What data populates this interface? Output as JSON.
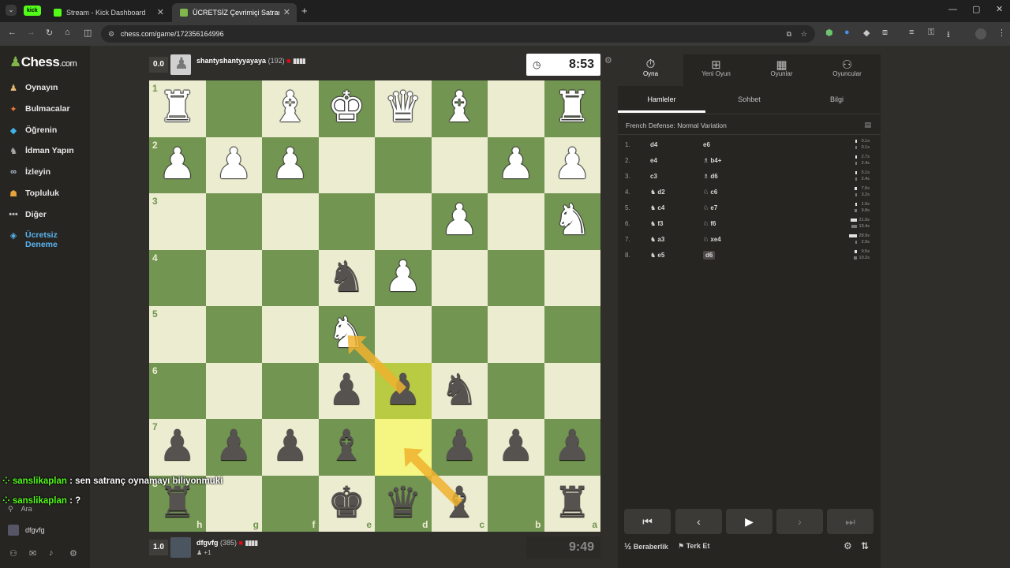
{
  "browser": {
    "tabs": [
      {
        "label": "Stream - Kick Dashboard"
      },
      {
        "label": "ÜCRETSİZ Çevrimiçi Satranç Oy"
      }
    ],
    "kick_badge": "kick",
    "url": "chess.com/game/172356164996"
  },
  "sidebar": {
    "logo": "Chess",
    "logo_suffix": ".com",
    "items": [
      {
        "label": "Oynayın",
        "icon": "pawn-icon"
      },
      {
        "label": "Bulmacalar",
        "icon": "puzzle-icon"
      },
      {
        "label": "Öğrenin",
        "icon": "graduation-cap-icon"
      },
      {
        "label": "İdman Yapın",
        "icon": "target-icon"
      },
      {
        "label": "İzleyin",
        "icon": "binoculars-icon"
      },
      {
        "label": "Topluluk",
        "icon": "community-icon"
      },
      {
        "label": "Diğer",
        "icon": "more-dots-icon"
      },
      {
        "label": "Ücretsiz Deneme",
        "icon": "diamond-icon"
      }
    ],
    "search_label": "Ara",
    "username": "dfgvfg"
  },
  "chat": [
    {
      "user": "sanslikaplan",
      "message": ": sen satranç oynamayı biliyonmuki"
    },
    {
      "user": "sanslikaplan",
      "message": ": ?"
    }
  ],
  "top_player": {
    "score": "0.0",
    "name": "shantyshantyyayaya",
    "rating": "(192)",
    "clock": "8:53"
  },
  "bottom_player": {
    "score": "1.0",
    "name": "dfgvfg",
    "rating": "(385)",
    "sub": "+1",
    "clock": "9:49"
  },
  "board": {
    "colors": {
      "light": "#ebecd0",
      "dark": "#739552",
      "highlight": "#f5f682",
      "highlight_dark": "#b9ca43",
      "arrow": "#f0b32e"
    },
    "rank_labels": [
      "1",
      "2",
      "3",
      "4",
      "5",
      "6",
      "7",
      "8"
    ],
    "file_labels": [
      "h",
      "g",
      "f",
      "e",
      "d",
      "c",
      "b",
      "a"
    ],
    "pieces": [
      {
        "glyph": "♜",
        "color": "w",
        "row": 0,
        "col": 0
      },
      {
        "glyph": "♝",
        "color": "w",
        "row": 0,
        "col": 2
      },
      {
        "glyph": "♚",
        "color": "w",
        "row": 0,
        "col": 3
      },
      {
        "glyph": "♛",
        "color": "w",
        "row": 0,
        "col": 4
      },
      {
        "glyph": "♝",
        "color": "w",
        "row": 0,
        "col": 5
      },
      {
        "glyph": "♜",
        "color": "w",
        "row": 0,
        "col": 7
      },
      {
        "glyph": "♟",
        "color": "w",
        "row": 1,
        "col": 0
      },
      {
        "glyph": "♟",
        "color": "w",
        "row": 1,
        "col": 1
      },
      {
        "glyph": "♟",
        "color": "w",
        "row": 1,
        "col": 2
      },
      {
        "glyph": "♟",
        "color": "w",
        "row": 1,
        "col": 6
      },
      {
        "glyph": "♟",
        "color": "w",
        "row": 1,
        "col": 7
      },
      {
        "glyph": "♟",
        "color": "w",
        "row": 2,
        "col": 5
      },
      {
        "glyph": "♞",
        "color": "w",
        "row": 2,
        "col": 7
      },
      {
        "glyph": "♞",
        "color": "b",
        "row": 3,
        "col": 3
      },
      {
        "glyph": "♟",
        "color": "w",
        "row": 3,
        "col": 4
      },
      {
        "glyph": "♞",
        "color": "w",
        "row": 4,
        "col": 3
      },
      {
        "glyph": "♟",
        "color": "b",
        "row": 5,
        "col": 3
      },
      {
        "glyph": "♟",
        "color": "b",
        "row": 5,
        "col": 4
      },
      {
        "glyph": "♞",
        "color": "b",
        "row": 5,
        "col": 5
      },
      {
        "glyph": "♟",
        "color": "b",
        "row": 6,
        "col": 0
      },
      {
        "glyph": "♟",
        "color": "b",
        "row": 6,
        "col": 1
      },
      {
        "glyph": "♟",
        "color": "b",
        "row": 6,
        "col": 2
      },
      {
        "glyph": "♝",
        "color": "b",
        "row": 6,
        "col": 3
      },
      {
        "glyph": "♟",
        "color": "b",
        "row": 6,
        "col": 5
      },
      {
        "glyph": "♟",
        "color": "b",
        "row": 6,
        "col": 6
      },
      {
        "glyph": "♟",
        "color": "b",
        "row": 6,
        "col": 7
      },
      {
        "glyph": "♜",
        "color": "b",
        "row": 7,
        "col": 0
      },
      {
        "glyph": "♚",
        "color": "b",
        "row": 7,
        "col": 3
      },
      {
        "glyph": "♛",
        "color": "b",
        "row": 7,
        "col": 4
      },
      {
        "glyph": "♝",
        "color": "b",
        "row": 7,
        "col": 5
      },
      {
        "glyph": "♜",
        "color": "b",
        "row": 7,
        "col": 7
      }
    ],
    "highlights": [
      {
        "row": 5,
        "col": 4,
        "kind": "hl2"
      },
      {
        "row": 6,
        "col": 4,
        "kind": "hl"
      }
    ],
    "arrows": [
      {
        "from": [
          5,
          4
        ],
        "to": [
          4,
          3
        ]
      },
      {
        "from": [
          7,
          5
        ],
        "to": [
          6,
          4
        ]
      }
    ]
  },
  "panel": {
    "tabs": [
      {
        "label": "Oyna",
        "icon": "stopwatch-icon"
      },
      {
        "label": "Yeni Oyun",
        "icon": "plus-square-icon"
      },
      {
        "label": "Oyunlar",
        "icon": "board-icon"
      },
      {
        "label": "Oyuncular",
        "icon": "players-icon"
      }
    ],
    "subtabs": [
      "Hamleler",
      "Sohbet",
      "Bilgi"
    ],
    "opening": "French Defense: Normal Variation",
    "moves": [
      {
        "n": "1.",
        "w": "d4",
        "b": "e6",
        "tw": "0.1s",
        "tb": "0.1s",
        "fw": 0.01,
        "fb": 0.01
      },
      {
        "n": "2.",
        "w": "e4",
        "b": "♗ b4+",
        "tw": "2.7s",
        "tb": "2.4s",
        "fw": 0.09,
        "fb": 0.08
      },
      {
        "n": "3.",
        "w": "c3",
        "b": "♗ d6",
        "tw": "5.1s",
        "tb": "2.4s",
        "fw": 0.18,
        "fb": 0.08
      },
      {
        "n": "4.",
        "w": "♞ d2",
        "b": "♘ c6",
        "tw": "7.6s",
        "tb": "3.2s",
        "fw": 0.27,
        "fb": 0.11
      },
      {
        "n": "5.",
        "w": "♞ c4",
        "b": "♘ e7",
        "tw": "1.9s",
        "tb": "9.8s",
        "fw": 0.07,
        "fb": 0.35
      },
      {
        "n": "6.",
        "w": "♞ f3",
        "b": "♘ f6",
        "tw": "21.9s",
        "tb": "19.4s",
        "fw": 0.78,
        "fb": 0.69
      },
      {
        "n": "7.",
        "w": "♞ a3",
        "b": "♘ xe4",
        "tw": "28.9s",
        "tb": "2.9s",
        "fw": 1.0,
        "fb": 0.1
      },
      {
        "n": "8.",
        "w": "♞ e5",
        "b": "d6",
        "tw": "9.5s",
        "tb": "10.2s",
        "fw": 0.34,
        "fb": 0.36
      }
    ],
    "draw_label": "Beraberlik",
    "draw_icon": "½",
    "resign_label": "Terk Et"
  }
}
